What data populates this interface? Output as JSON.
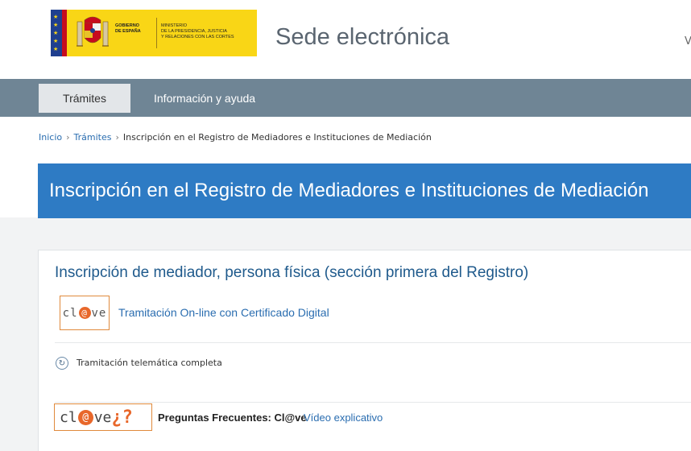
{
  "header": {
    "gov_logo_left": "GOBIERNO\nDE ESPAÑA",
    "gov_logo_right": "MINISTERIO\nDE LA PRESIDENCIA, JUSTICIA\nY RELACIONES CON LAS CORTES",
    "site_title": "Sede electrónica",
    "cut_text": "V"
  },
  "nav": {
    "tabs": [
      {
        "label": "Trámites",
        "active": true
      },
      {
        "label": "Información y ayuda",
        "active": false
      }
    ]
  },
  "breadcrumb": {
    "items": [
      "Inicio",
      "Trámites"
    ],
    "current": "Inscripción en el Registro de Mediadores e Instituciones de Mediación",
    "separator": "›"
  },
  "banner": {
    "title": "Inscripción en el Registro de Mediadores e Instituciones de Mediación"
  },
  "card": {
    "title": "Inscripción de mediador, persona física (sección primera del Registro)",
    "clave_logo": {
      "pre": "cl",
      "at": "@",
      "post": "ve"
    },
    "online_link": "Tramitación On-line con Certificado Digital",
    "telematic_text": "Tramitación telemática completa",
    "faq_logo": {
      "pre": "cl",
      "at": "@",
      "post": "ve",
      "q": "¿?"
    },
    "faq_label": "Preguntas Frecuentes: Cl@ve",
    "faq_link": "Vídeo explicativo"
  },
  "colors": {
    "nav_bg": "#6f8595",
    "banner_bg": "#2e7bc4",
    "link": "#2a6db0",
    "clave_orange": "#e8672a",
    "gov_yellow": "#f9d616"
  }
}
